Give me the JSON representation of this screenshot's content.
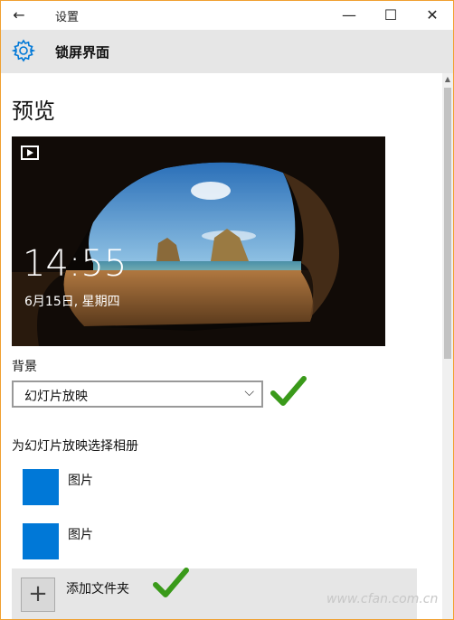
{
  "titlebar": {
    "back_glyph": "←",
    "title": "设置",
    "minimize_glyph": "—",
    "maximize_glyph": "☐",
    "close_glyph": "✕"
  },
  "header": {
    "icon": "gear-icon",
    "title": "锁屏界面"
  },
  "main": {
    "section_title": "预览",
    "preview": {
      "icon": "slideshow-icon",
      "time": "14:55",
      "date": "6月15日, 星期四"
    },
    "background": {
      "label": "背景",
      "selected": "幻灯片放映",
      "chevron_glyph": "⌵"
    },
    "albums_heading": "为幻灯片放映选择相册",
    "albums": [
      {
        "label": "图片",
        "color": "#0078d7"
      },
      {
        "label": "图片",
        "color": "#0078d7"
      }
    ],
    "add_folder": {
      "glyph": "+",
      "label": "添加文件夹"
    }
  },
  "watermark": "www.cfan.com.cn",
  "colors": {
    "accent": "#0078d7",
    "check": "#3a9a1a",
    "window_border": "#f0a030"
  }
}
